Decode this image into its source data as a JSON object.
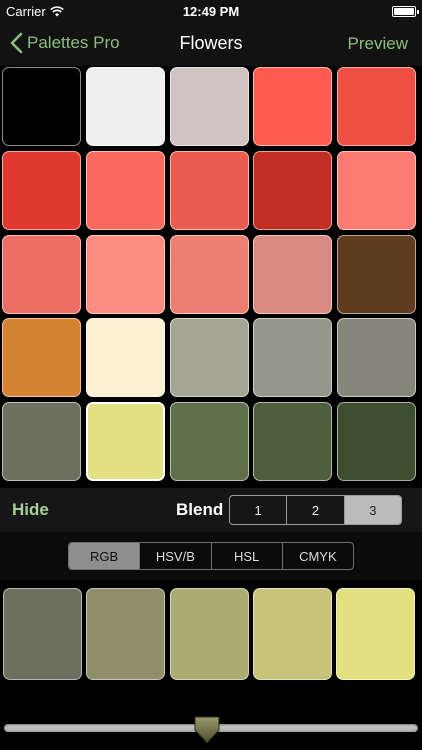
{
  "status": {
    "carrier": "Carrier",
    "time": "12:49 PM",
    "battery_level": 1.0
  },
  "nav": {
    "back_label": "Palettes Pro",
    "title": "Flowers",
    "preview_label": "Preview"
  },
  "palette": {
    "columns": 5,
    "selected_index": 21,
    "colors": [
      "#000000",
      "#efefef",
      "#d2c3c3",
      "#fd5b4e",
      "#ef4f42",
      "#e0392e",
      "#fb6a5e",
      "#ea5b50",
      "#c12e24",
      "#fa7b71",
      "#ee6d64",
      "#fb8c81",
      "#ec7e72",
      "#d88a80",
      "#603c1f",
      "#d58232",
      "#fdefd2",
      "#a5a593",
      "#95978a",
      "#86877a",
      "#6e705f",
      "#e3e081",
      "#5e704b",
      "#4e5f3d",
      "#3e4d2d"
    ]
  },
  "blend": {
    "hide_label": "Hide",
    "label": "Blend",
    "options": [
      "1",
      "2",
      "3"
    ],
    "active_index": 2
  },
  "color_mode": {
    "options": [
      "RGB",
      "HSV/B",
      "HSL",
      "CMYK"
    ],
    "active_index": 0
  },
  "blend_colors": [
    "#6e705f",
    "#8f9069",
    "#acab72",
    "#c7c47a",
    "#e3e081"
  ],
  "slider": {
    "value": 0.5
  },
  "icons": {
    "signal": "wifi-icon",
    "battery": "battery-icon",
    "back": "chevron-left-icon",
    "thumb": "slider-thumb-icon"
  }
}
